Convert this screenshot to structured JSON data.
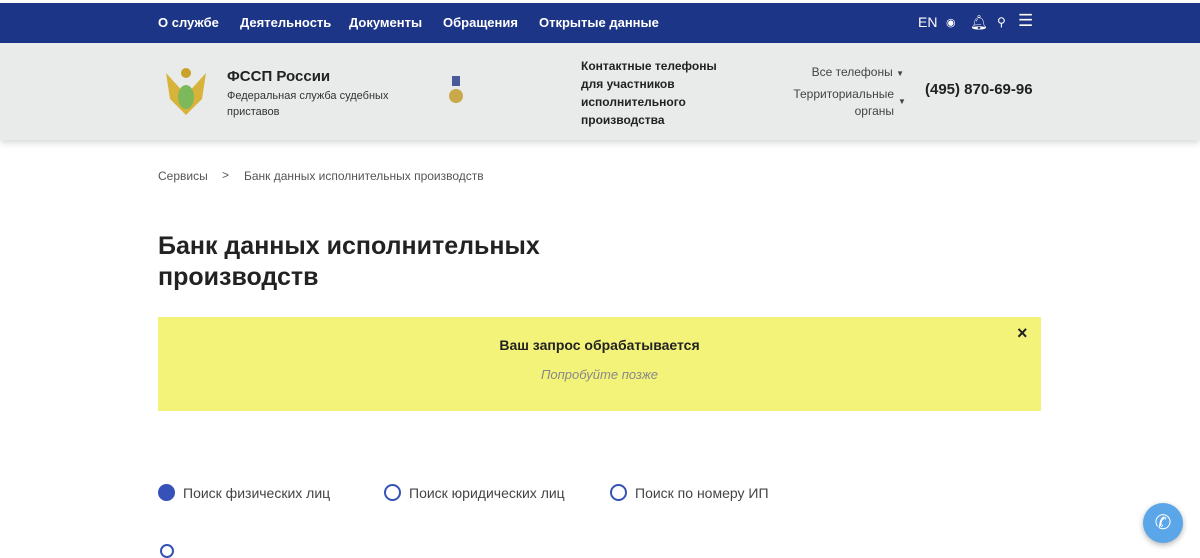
{
  "nav": {
    "items": [
      "О службе",
      "Деятельность",
      "Документы",
      "Обращения",
      "Открытые данные"
    ],
    "lang": "EN"
  },
  "header": {
    "org_name": "ФССП России",
    "org_full": "Федеральная служба судебных приставов",
    "contacts_title": "Контактные телефоны для участников исполнительного производства",
    "all_phones": "Все телефоны",
    "territorial": "Территориальные органы",
    "phone": "(495) 870-69-96"
  },
  "breadcrumb": {
    "parent": "Сервисы",
    "sep": ">",
    "current": "Банк данных исполнительных производств"
  },
  "page": {
    "title": "Банк данных исполнительных производств"
  },
  "alert": {
    "title": "Ваш запрос обрабатывается",
    "subtitle": "Попробуйте позже",
    "close": "×"
  },
  "search_types": [
    {
      "label": "Поиск физических лиц",
      "selected": true
    },
    {
      "label": "Поиск юридических лиц",
      "selected": false
    },
    {
      "label": "Поиск по номеру ИП",
      "selected": false
    }
  ],
  "colors": {
    "nav": "#1d3586",
    "alert": "#f3f37a",
    "accent": "#3652b8"
  }
}
